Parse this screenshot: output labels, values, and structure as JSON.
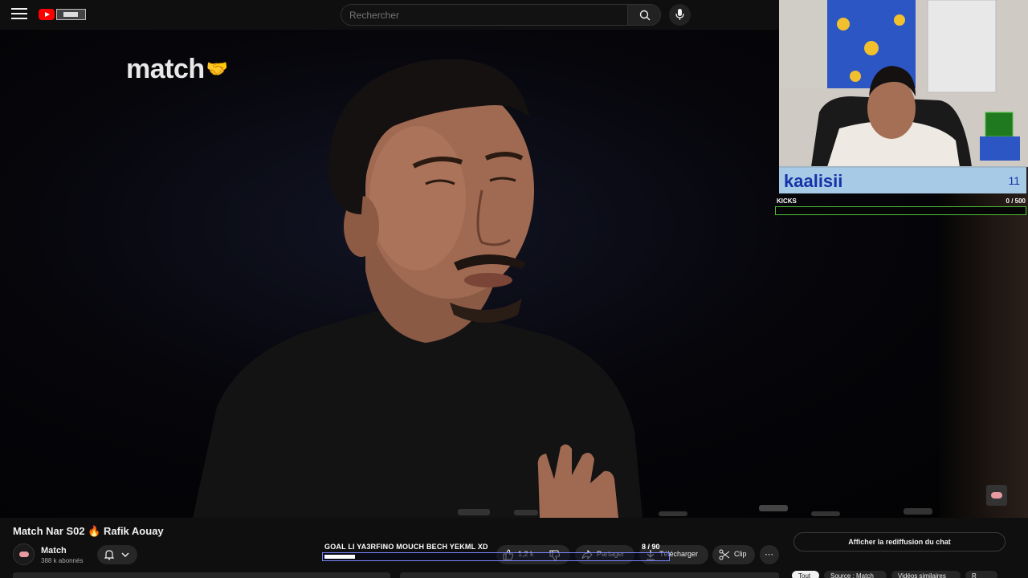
{
  "header": {
    "menu_icon": "hamburger-menu-icon",
    "search_placeholder": "Rechercher",
    "search_icon": "search-icon",
    "mic_icon": "microphone-icon"
  },
  "player": {
    "video_logo_text": "match",
    "kick_overlay": {
      "streamer_name": "kaalisii",
      "streamer_count": "11",
      "kicks_label": "KICKS",
      "kicks_progress": "0  / 500"
    },
    "goal": {
      "label": "GOAL LI YA3RFINO MOUCH BECH YEKML XD",
      "count": "8  / 90",
      "progress_fraction": 0.089
    }
  },
  "video": {
    "title": "Match Nar S02 🔥 Rafik Aouay",
    "channel": "Match",
    "subscribers": "388 k abonnés"
  },
  "actions": {
    "likes": "1,2 k",
    "share": "Partager",
    "download": "Télécharger",
    "clip": "Clip",
    "more": "⋯"
  },
  "sidebar": {
    "chat_replay": "Afficher la rediffusion du chat",
    "filters": [
      "Tout",
      "Source : Match",
      "Vidéos similaires",
      "R"
    ]
  },
  "colors": {
    "background": "#0f0f0f",
    "youtube_red": "#ff0000",
    "overlay_name_bg": "#a7cbe6",
    "overlay_name_text": "#1532a8",
    "kicks_border": "#4fc23b",
    "goal_border": "#7b86ff"
  }
}
